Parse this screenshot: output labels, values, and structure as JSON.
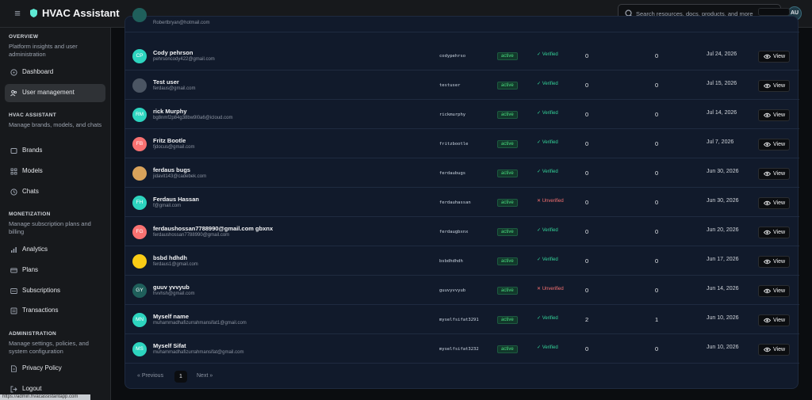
{
  "header": {
    "title": "HVAC Assistant",
    "search_placeholder": "Search resources, docs, products, and more",
    "avatar_initials": "AU"
  },
  "sidebar": {
    "sections": [
      {
        "title": "OVERVIEW",
        "desc": "Platform insights and user administration"
      },
      {
        "title": "HVAC ASSISTANT",
        "desc": "Manage brands, models, and chats"
      },
      {
        "title": "MONETIZATION",
        "desc": "Manage subscription plans and billing"
      },
      {
        "title": "ADMINISTRATION",
        "desc": "Manage settings, policies, and system configuration"
      }
    ],
    "items": [
      {
        "label": "Dashboard",
        "icon": "gauge-icon"
      },
      {
        "label": "User management",
        "icon": "users-icon",
        "active": true
      },
      {
        "label": "Brands",
        "icon": "box-icon"
      },
      {
        "label": "Models",
        "icon": "grid-icon"
      },
      {
        "label": "Chats",
        "icon": "clock-icon"
      },
      {
        "label": "Analytics",
        "icon": "bar-chart-icon"
      },
      {
        "label": "Plans",
        "icon": "card-icon"
      },
      {
        "label": "Subscriptions",
        "icon": "wallet-icon"
      },
      {
        "label": "Transactions",
        "icon": "list-icon"
      },
      {
        "label": "Privacy Policy",
        "icon": "document-icon"
      },
      {
        "label": "Logout",
        "icon": "logout-icon"
      }
    ],
    "status_url": "https://admin.hvacassistantapp.com"
  },
  "table": {
    "view_label": "View",
    "partial_email": "Robertbryan@hotmail.com",
    "rows": [
      {
        "initials": "CP",
        "avatar_color": "#2dd4bf",
        "name": "Cody pehrson",
        "email": "pehrsoncody422@gmail.com",
        "handle": "codypehrso",
        "status": "active",
        "verification": "Verified",
        "verified": true,
        "count1": "0",
        "count2": "0",
        "date": "Jul 24, 2026"
      },
      {
        "initials": "",
        "avatar_color": "#4b5563",
        "name": "Test user",
        "email": "ferdaus@gmail.com",
        "handle": "testuser",
        "status": "active",
        "verification": "Verified",
        "verified": true,
        "count1": "0",
        "count2": "0",
        "date": "Jul 15, 2026"
      },
      {
        "initials": "RM",
        "avatar_color": "#2dd4bf",
        "name": "rick Murphy",
        "email": "bg8nmf2p84g38bw9l0a6@icloud.com",
        "handle": "rickmurphy",
        "status": "active",
        "verification": "Verified",
        "verified": true,
        "count1": "0",
        "count2": "0",
        "date": "Jul 14, 2026"
      },
      {
        "initials": "FB",
        "avatar_color": "#f87171",
        "name": "Fritz Bootle",
        "email": "fjdocus@gmail.com",
        "handle": "fritzbootle",
        "status": "active",
        "verification": "Verified",
        "verified": true,
        "count1": "0",
        "count2": "0",
        "date": "Jul 7, 2026"
      },
      {
        "initials": "",
        "avatar_color": "#d9a35b",
        "name": "ferdaus bugs",
        "email": "jidavit143@cadebek.com",
        "handle": "ferdaubugs",
        "status": "active",
        "verification": "Verified",
        "verified": true,
        "count1": "0",
        "count2": "0",
        "date": "Jun 30, 2026"
      },
      {
        "initials": "FH",
        "avatar_color": "#2dd4bf",
        "name": "Ferdaus Hassan",
        "email": "f@gmail.com",
        "handle": "ferdauhassan",
        "status": "active",
        "verification": "Unverified",
        "verified": false,
        "count1": "0",
        "count2": "0",
        "date": "Jun 30, 2026"
      },
      {
        "initials": "FG",
        "avatar_color": "#f87171",
        "name": "ferdaushossan7788990@gmail.com gbxnx",
        "email": "ferdaushossan7788990@gmail.com",
        "handle": "ferdaugbxnx",
        "status": "active",
        "verification": "Verified",
        "verified": true,
        "count1": "0",
        "count2": "0",
        "date": "Jun 20, 2026"
      },
      {
        "initials": "",
        "avatar_color": "#facc15",
        "name": "bsbd hdhdh",
        "email": "ferdaus1@gmail.com",
        "handle": "bsbdhdhdh",
        "status": "active",
        "verification": "Verified",
        "verified": true,
        "count1": "0",
        "count2": "0",
        "date": "Jun 17, 2026"
      },
      {
        "initials": "GY",
        "avatar_color": "#1f5f5b",
        "name": "guuv yvvyub",
        "email": "hvvhsh@gmail.com",
        "handle": "guuvyvvyub",
        "status": "active",
        "verification": "Unverified",
        "verified": false,
        "count1": "0",
        "count2": "0",
        "date": "Jun 14, 2026"
      },
      {
        "initials": "MN",
        "avatar_color": "#2dd4bf",
        "name": "Myself name",
        "email": "muhammadhafizurrahmansifat1@gmail.com",
        "handle": "myselfsifat3291",
        "status": "active",
        "verification": "Verified",
        "verified": true,
        "count1": "2",
        "count2": "1",
        "date": "Jun 10, 2026"
      },
      {
        "initials": "MS",
        "avatar_color": "#2dd4bf",
        "name": "Myself Sifat",
        "email": "muhammadhafizurrahmansifat@gmail.com",
        "handle": "myselfsifat3232",
        "status": "active",
        "verification": "Verified",
        "verified": true,
        "count1": "0",
        "count2": "0",
        "date": "Jun 10, 2026"
      }
    ]
  },
  "pagination": {
    "prev": "« Previous",
    "current": "1",
    "next": "Next »"
  }
}
